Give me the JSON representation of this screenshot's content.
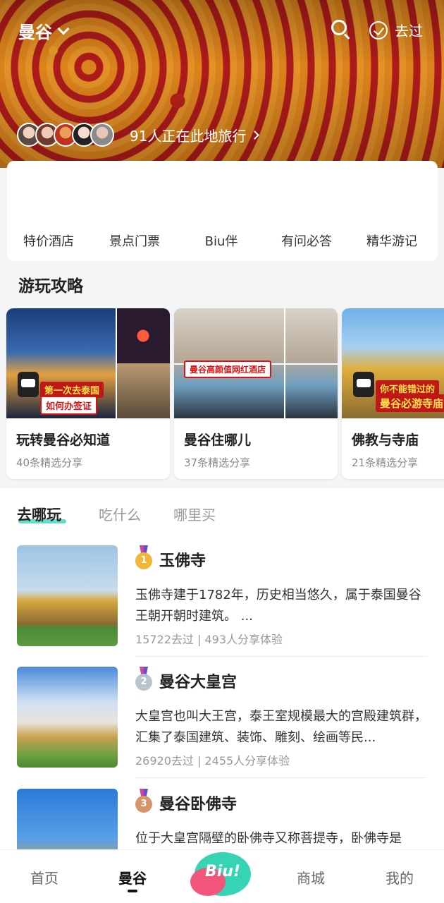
{
  "header": {
    "city": "曼谷",
    "been_label": "去过",
    "travelers_text": "91人正在此地旅行"
  },
  "quick_nav": [
    "特价酒店",
    "景点门票",
    "Biu伴",
    "有问必答",
    "精华游记"
  ],
  "guides": {
    "title": "游玩攻略",
    "cards": [
      {
        "title": "玩转曼谷必知道",
        "sub": "40条精选分享",
        "banner1": "第一次去泰国",
        "banner2": "如何办签证"
      },
      {
        "title": "曼谷住哪儿",
        "sub": "37条精选分享",
        "banner1": "曼谷高颜值网红酒店"
      },
      {
        "title": "佛教与寺庙",
        "sub": "21条精选分享",
        "banner1": "你不能错过的",
        "banner2": "曼谷必游寺庙"
      }
    ]
  },
  "tabs": [
    "去哪玩",
    "吃什么",
    "哪里买"
  ],
  "pois": [
    {
      "rank": "1",
      "name": "玉佛寺",
      "desc": "玉佛寺建于1782年，历史相当悠久，属于泰国曼谷王朝开朝时建筑。 ...",
      "stats": "15722去过 | 493人分享体验"
    },
    {
      "rank": "2",
      "name": "曼谷大皇宫",
      "desc": "大皇宫也叫大王宫，泰王室规模最大的宫殿建筑群，汇集了泰国建筑、装饰、雕刻、绘画等民...",
      "stats": "26920去过 | 2455人分享体验"
    },
    {
      "rank": "3",
      "name": "曼谷卧佛寺",
      "desc": "位于大皇宫隔壁的卧佛寺又称菩提寺，卧佛寺是",
      "stats": ""
    }
  ],
  "bottom_nav": {
    "home": "首页",
    "city": "曼谷",
    "biu": "Biu!",
    "mall": "商城",
    "mine": "我的"
  },
  "colors": {
    "accent": "#3fd5c0",
    "biu_green": "#36d4b4",
    "biu_pink": "#f2567a",
    "gold": "#f2b636",
    "silver": "#b9c4cf",
    "bronze": "#d9956a"
  }
}
